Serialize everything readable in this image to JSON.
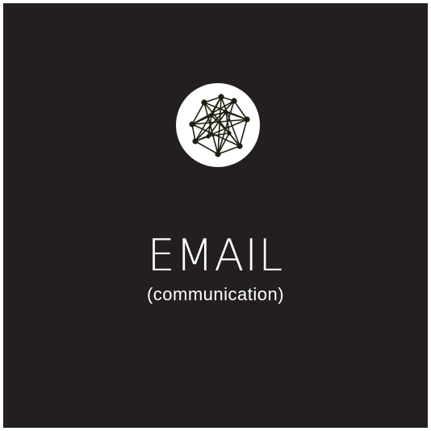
{
  "card": {
    "background_color": "#231f20",
    "icon": "network-mesh-icon",
    "title": "EMAIL",
    "subtitle": "(communication)"
  }
}
